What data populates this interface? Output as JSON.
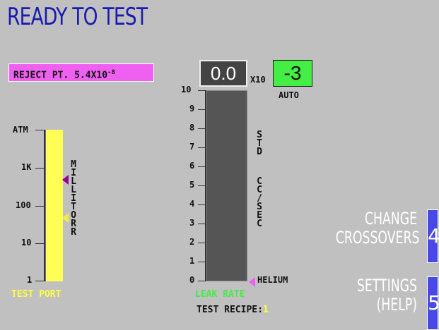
{
  "header": {
    "title": "READY TO TEST"
  },
  "reject_point": {
    "prefix": "REJECT PT. 5.4X10",
    "exponent": "-8"
  },
  "test_port": {
    "scale_labels": [
      "ATM",
      "1K",
      "100",
      "10",
      "1"
    ],
    "unit_letters": [
      "M",
      "I",
      "L",
      "L",
      "I",
      "T",
      "O",
      "R",
      "R"
    ],
    "label": "TEST PORT"
  },
  "leak_rate": {
    "scale_labels": [
      "10",
      "9",
      "8",
      "7",
      "6",
      "5",
      "4",
      "3",
      "2",
      "1",
      "0"
    ],
    "mantissa": "0.0",
    "multiplier": "X10",
    "exponent": "-3",
    "range_mode": "AUTO",
    "unit_line1": "STD",
    "unit_line2": "CC/SEC",
    "gas": "HELIUM",
    "label": "LEAK RATE",
    "value": 0
  },
  "recipe": {
    "label": "TEST RECIPE:",
    "number": "1"
  },
  "softkeys": [
    {
      "line1": "CHANGE",
      "line2": "CROSSOVERS",
      "number": "4"
    },
    {
      "line1": "SETTINGS",
      "line2": "(HELP)",
      "number": "5"
    }
  ],
  "colors": {
    "background": "#c0c0c0",
    "title": "#1a1ab0",
    "reject_bg": "#f060f0",
    "port_bar": "#ffff55",
    "softkey_button": "#4848e8",
    "exponent_bg": "#44ee44"
  }
}
